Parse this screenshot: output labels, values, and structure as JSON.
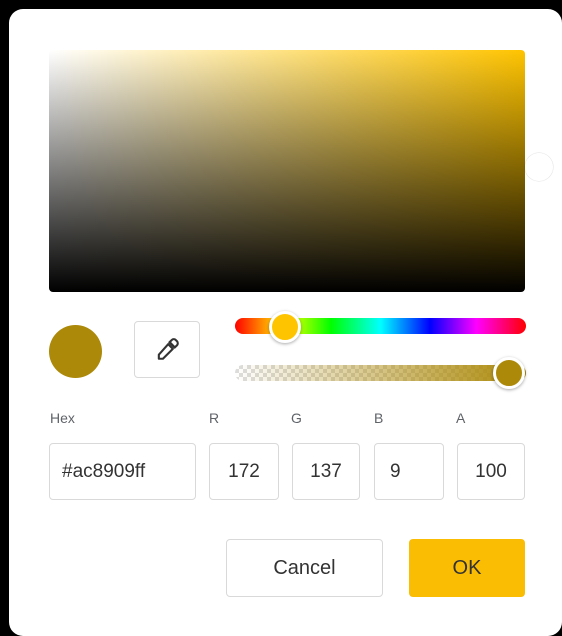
{
  "colors": {
    "current": "#ac8909",
    "hue": "#ffc400",
    "ok_button": "#fbbc04"
  },
  "picker": {
    "saturation_value_handle": "selected-color-position",
    "hue_slider_value": 0.12,
    "alpha_slider_value": 1.0
  },
  "icons": {
    "eyedropper": "eyedropper-icon"
  },
  "fields": {
    "hex": {
      "label": "Hex",
      "value": "#ac8909ff"
    },
    "r": {
      "label": "R",
      "value": "172"
    },
    "g": {
      "label": "G",
      "value": "137"
    },
    "b": {
      "label": "B",
      "value": "9"
    },
    "a": {
      "label": "A",
      "value": "100"
    }
  },
  "buttons": {
    "cancel": "Cancel",
    "ok": "OK"
  }
}
